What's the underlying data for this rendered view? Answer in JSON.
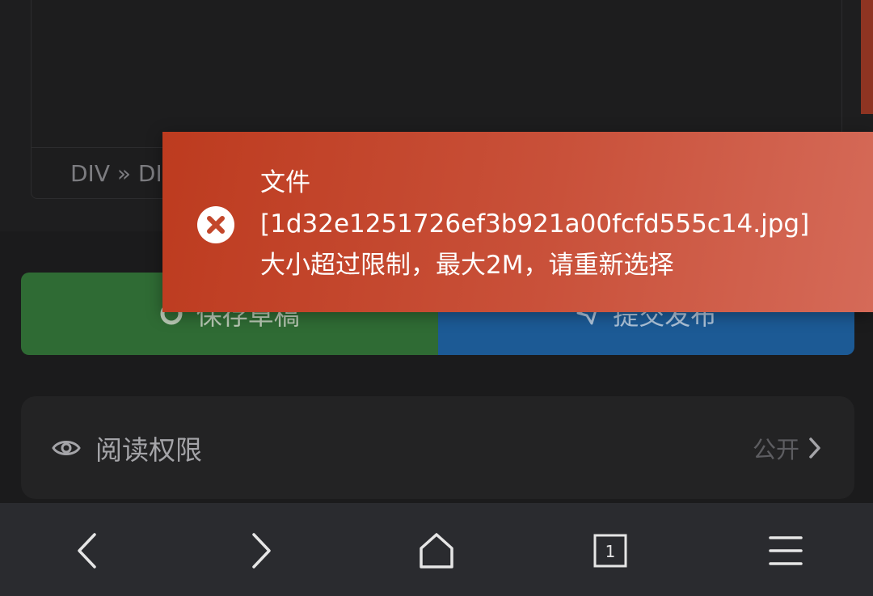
{
  "editor": {
    "status_path": "DIV » DIV"
  },
  "actions": {
    "save_label": "保存草稿",
    "submit_label": "提交发布"
  },
  "permission": {
    "title": "阅读权限",
    "value": "公开"
  },
  "toast": {
    "message": "文件\n[1d32e1251726ef3b921a00fcfd555c14.jpg]\n大小超过限制，最大2M，请重新选择",
    "type": "error"
  },
  "navbar": {
    "tab_count": "1",
    "items": [
      "back-icon",
      "forward-icon",
      "home-icon",
      "tabs-icon",
      "menu-icon"
    ]
  },
  "colors": {
    "toast_start": "#bd3b1f",
    "toast_end": "#d56a58",
    "save_green": "#2f6b34",
    "submit_blue": "#1c5a95"
  }
}
